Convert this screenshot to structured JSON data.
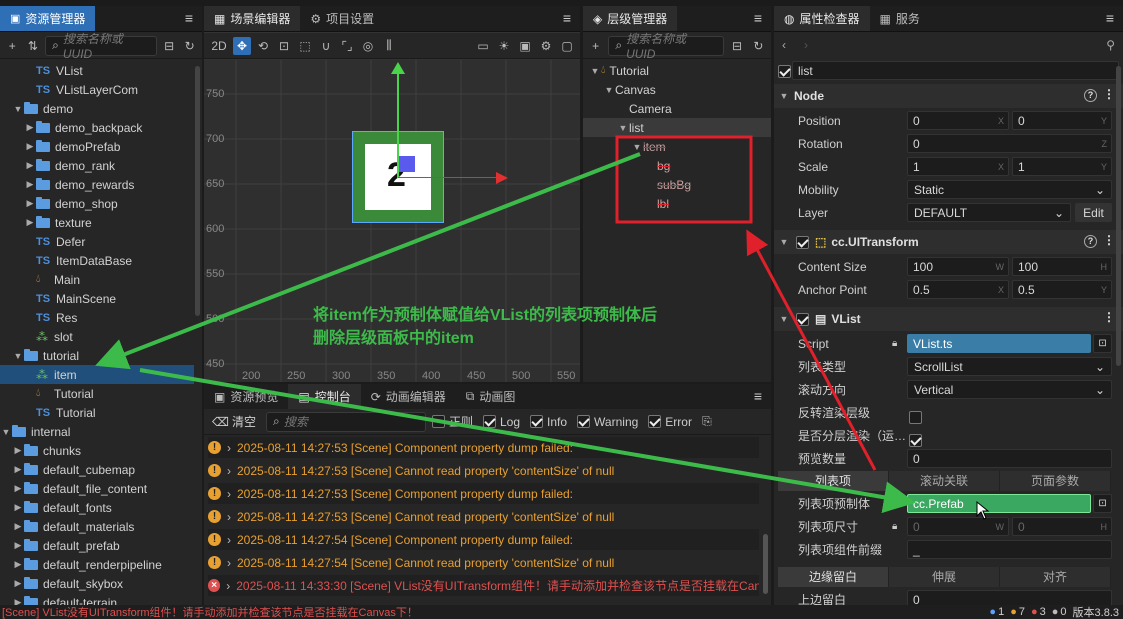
{
  "assets": {
    "tab": "资源管理器",
    "search_placeholder": "搜索名称或 UUID",
    "rows": [
      {
        "label": "VList",
        "type": "ts",
        "indent": 1
      },
      {
        "label": "VListLayerCom",
        "type": "ts",
        "indent": 1
      },
      {
        "label": "demo",
        "type": "folder",
        "indent": 0,
        "open": true
      },
      {
        "label": "demo_backpack",
        "type": "folder",
        "indent": 1
      },
      {
        "label": "demoPrefab",
        "type": "folder",
        "indent": 1
      },
      {
        "label": "demo_rank",
        "type": "folder",
        "indent": 1
      },
      {
        "label": "demo_rewards",
        "type": "folder",
        "indent": 1
      },
      {
        "label": "demo_shop",
        "type": "folder",
        "indent": 1
      },
      {
        "label": "texture",
        "type": "folder",
        "indent": 1
      },
      {
        "label": "Defer",
        "type": "ts",
        "indent": 1
      },
      {
        "label": "ItemDataBase",
        "type": "ts",
        "indent": 1
      },
      {
        "label": "Main",
        "type": "scene",
        "indent": 1
      },
      {
        "label": "MainScene",
        "type": "ts",
        "indent": 1
      },
      {
        "label": "Res",
        "type": "ts",
        "indent": 1
      },
      {
        "label": "slot",
        "type": "prefab",
        "indent": 1
      },
      {
        "label": "tutorial",
        "type": "folder",
        "indent": 0,
        "open": true
      },
      {
        "label": "item",
        "type": "prefab",
        "indent": 1,
        "selected": true
      },
      {
        "label": "Tutorial",
        "type": "scene",
        "indent": 1
      },
      {
        "label": "Tutorial",
        "type": "ts",
        "indent": 1
      },
      {
        "label": "internal",
        "type": "folder",
        "indent": -1,
        "open": true
      },
      {
        "label": "chunks",
        "type": "folder",
        "indent": 0
      },
      {
        "label": "default_cubemap",
        "type": "folder",
        "indent": 0
      },
      {
        "label": "default_file_content",
        "type": "folder",
        "indent": 0
      },
      {
        "label": "default_fonts",
        "type": "folder",
        "indent": 0
      },
      {
        "label": "default_materials",
        "type": "folder",
        "indent": 0
      },
      {
        "label": "default_prefab",
        "type": "folder",
        "indent": 0
      },
      {
        "label": "default_renderpipeline",
        "type": "folder",
        "indent": 0
      },
      {
        "label": "default_skybox",
        "type": "folder",
        "indent": 0
      },
      {
        "label": "default-terrain",
        "type": "folder",
        "indent": 0
      }
    ]
  },
  "scene": {
    "tab1": "场景编辑器",
    "tab2": "项目设置",
    "mode": "2D",
    "y_ticks": [
      "750",
      "700",
      "650",
      "600",
      "550",
      "500",
      "450"
    ],
    "x_ticks": [
      "200",
      "250",
      "300",
      "350",
      "400",
      "450",
      "500",
      "550"
    ],
    "node_text": "2"
  },
  "hierarchy": {
    "tab": "层级管理器",
    "search_placeholder": "搜索名称或 UUID",
    "rows": [
      {
        "label": "Tutorial",
        "indent": 0
      },
      {
        "label": "Canvas",
        "indent": 1
      },
      {
        "label": "Camera",
        "indent": 2
      },
      {
        "label": "list",
        "indent": 2,
        "selected": true
      },
      {
        "label": "item",
        "indent": 3,
        "struck": true
      },
      {
        "label": "bg",
        "indent": 4,
        "struck": true
      },
      {
        "label": "subBg",
        "indent": 4,
        "struck": true
      },
      {
        "label": "lbl",
        "indent": 4,
        "struck": true
      }
    ]
  },
  "inspector": {
    "tab1": "属性检查器",
    "tab2": "服务",
    "node_name": "list",
    "node_section": "Node",
    "position_label": "Position",
    "position_x": "0",
    "position_y": "0",
    "rotation_label": "Rotation",
    "rotation_z": "0",
    "scale_label": "Scale",
    "scale_x": "1",
    "scale_y": "1",
    "mobility_label": "Mobility",
    "mobility_value": "Static",
    "layer_label": "Layer",
    "layer_value": "DEFAULT",
    "edit_label": "Edit",
    "uitransform_section": "cc.UITransform",
    "content_size_label": "Content Size",
    "content_w": "100",
    "content_h": "100",
    "anchor_label": "Anchor Point",
    "anchor_x": "0.5",
    "anchor_y": "0.5",
    "vlist_section": "VList",
    "script_label": "Script",
    "script_value": "VList.ts",
    "list_type_label": "列表类型",
    "list_type_value": "ScrollList",
    "scroll_dir_label": "滚动方向",
    "scroll_dir_value": "Vertical",
    "reverse_label": "反转渲染层级",
    "layered_label": "是否分层渲染（运…",
    "preload_label": "预览数量",
    "preload_value": "0",
    "subtabs": [
      "列表项",
      "滚动关联",
      "页面参数"
    ],
    "prefab_label": "列表项预制体",
    "prefab_value": "cc.Prefab",
    "item_size_label": "列表项尺寸",
    "item_size_w": "0",
    "item_size_h": "0",
    "prefix_label": "列表项组件前缀",
    "prefix_value": "_",
    "subtabs2": [
      "边缘留白",
      "伸展",
      "对齐"
    ],
    "top_margin_label": "上边留白",
    "top_margin_value": "0"
  },
  "console": {
    "tabs": [
      "资源预览",
      "控制台",
      "动画编辑器",
      "动画图"
    ],
    "clear_label": "清空",
    "search_placeholder": "搜索",
    "filters": [
      "正则",
      "Log",
      "Info",
      "Warning",
      "Error"
    ],
    "logs": [
      {
        "level": "warn",
        "text": "2025-08-11 14:27:53 [Scene] Component property dump failed:"
      },
      {
        "level": "warn",
        "text": "2025-08-11 14:27:53 [Scene] Cannot read property 'contentSize' of null"
      },
      {
        "level": "warn",
        "text": "2025-08-11 14:27:53 [Scene] Component property dump failed:"
      },
      {
        "level": "warn",
        "text": "2025-08-11 14:27:53 [Scene] Cannot read property 'contentSize' of null"
      },
      {
        "level": "warn",
        "text": "2025-08-11 14:27:54 [Scene] Component property dump failed:"
      },
      {
        "level": "warn",
        "text": "2025-08-11 14:27:54 [Scene] Cannot read property 'contentSize' of null"
      },
      {
        "level": "error",
        "text": "2025-08-11 14:33:30 [Scene] VList没有UITransform组件！请手动添加并检查该节点是否挂载在Canvas下"
      }
    ]
  },
  "status": {
    "message": "[Scene] VList没有UITransform组件！请手动添加并检查该节点是否挂载在Canvas下！",
    "info_count": "1",
    "warn_count": "7",
    "error_count": "3",
    "other_count": "0",
    "version": "版本3.8.3"
  },
  "annotation": {
    "line1": "将item作为预制体赋值给VList的列表项预制体后",
    "line2": "删除层级面板中的item"
  },
  "colors": {
    "accent": "#2f6fb5",
    "green": "#3dbb4a",
    "red": "#e0202a",
    "warn": "#e8a030",
    "error": "#e05050"
  }
}
